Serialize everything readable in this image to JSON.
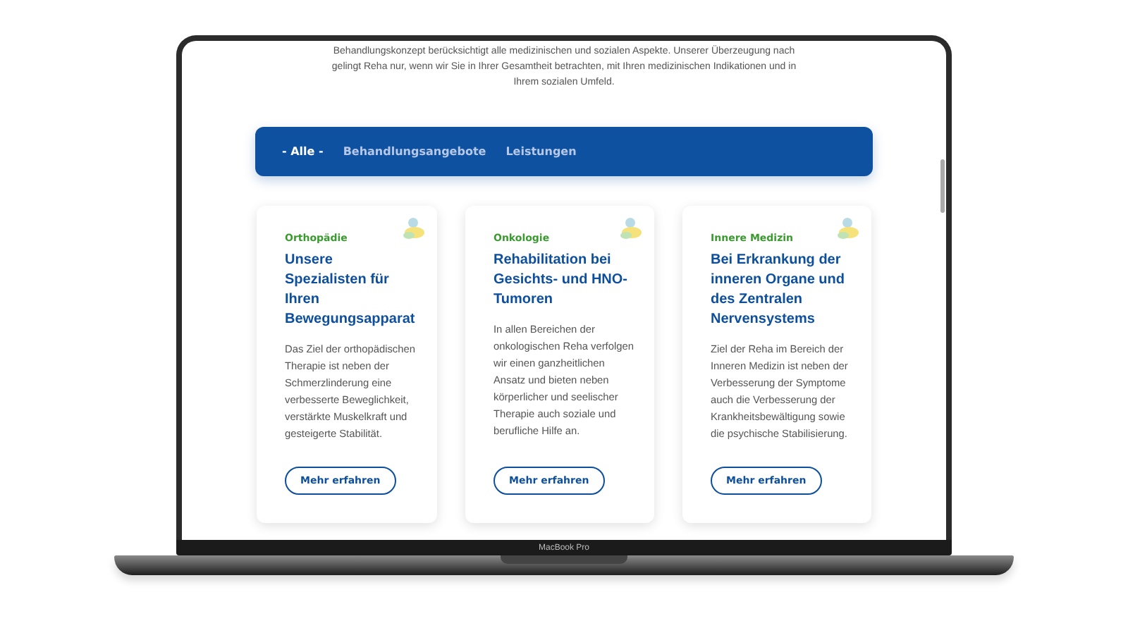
{
  "device": {
    "label": "MacBook Pro"
  },
  "intro": {
    "lines": [
      "Behandlungskonzept berücksichtigt alle medizinischen und sozialen Aspekte. Unserer Überzeugung nach",
      "gelingt Reha nur, wenn wir Sie in Ihrer Gesamtheit betrachten, mit Ihren medizinischen Indikationen und in",
      "Ihrem sozialen Umfeld."
    ]
  },
  "tabs": [
    {
      "label": "- Alle -",
      "selected": true
    },
    {
      "label": "Behandlungsangebote",
      "selected": false
    },
    {
      "label": "Leistungen",
      "selected": false
    }
  ],
  "cards": [
    {
      "category": "Orthopädie",
      "title": "Unsere Spezialisten für Ihren Bewegungsapparat",
      "text": "Das Ziel der orthopädischen Therapie ist neben der Schmerzlinderung eine verbesserte Beweglichkeit, verstärkte Muskelkraft und gesteigerte Stabilität.",
      "button": "Mehr erfahren"
    },
    {
      "category": "Onkologie",
      "title": "Rehabilitation bei Gesichts- und HNO-Tumoren",
      "text": "In allen Bereichen der onkologischen Reha verfolgen wir einen ganzheitlichen Ansatz und bieten neben körperlicher und seelischer Therapie auch soziale und berufliche Hilfe an.",
      "button": "Mehr erfahren"
    },
    {
      "category": "Innere Medizin",
      "title": "Bei Erkrankung der inneren Organe und des Zentralen Nervensystems",
      "text": "Ziel der Reha im Bereich der Inneren Medizin ist neben der Verbesserung der Symptome auch die Verbesserung der Krankheitsbewältigung sowie die psychische Stabilisierung.",
      "button": "Mehr erfahren"
    }
  ]
}
